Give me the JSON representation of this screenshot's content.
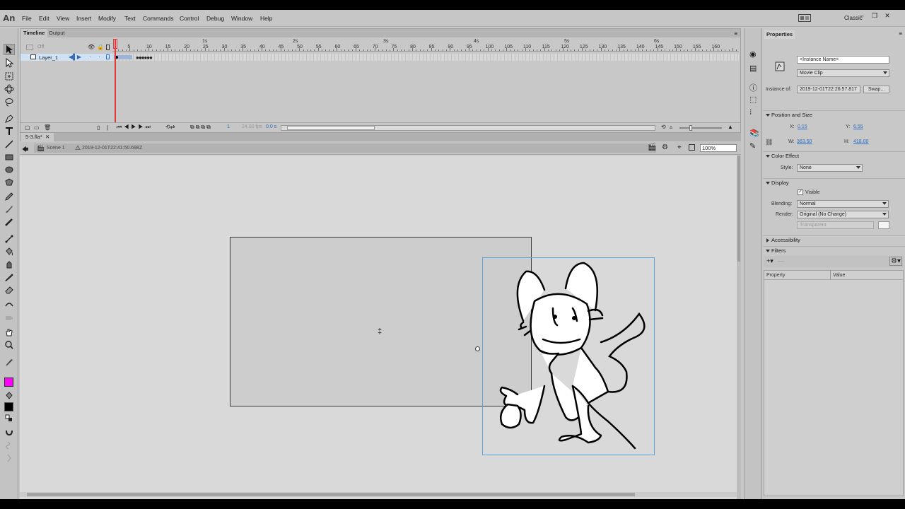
{
  "app": {
    "logo": "An",
    "workspace": "Classic"
  },
  "menu": [
    "File",
    "Edit",
    "View",
    "Insert",
    "Modify",
    "Text",
    "Commands",
    "Control",
    "Debug",
    "Window",
    "Help"
  ],
  "timeline": {
    "tabs": [
      "Timeline",
      "Output"
    ],
    "off_label": "Off",
    "layer_name": "Layer_1",
    "ruler_numbers": [
      "5",
      "10",
      "15",
      "20",
      "25",
      "30",
      "35",
      "40",
      "45",
      "50",
      "55",
      "60",
      "65",
      "70",
      "75",
      "80",
      "85",
      "90",
      "95",
      "100",
      "105",
      "110",
      "115",
      "120",
      "125",
      "130",
      "135",
      "140",
      "145",
      "150",
      "155",
      "160"
    ],
    "seconds": [
      "1s",
      "2s",
      "3s",
      "4s",
      "5s",
      "6s"
    ],
    "current_frame": "1",
    "fps": "24.00 fps",
    "time": "0.0 s"
  },
  "document": {
    "tab_name": "5-3.fla*",
    "scene": "Scene 1",
    "symbol": "2019-12-01T22:41:50.698Z",
    "zoom": "100%"
  },
  "properties": {
    "tab": "Properties",
    "instance_name_placeholder": "<Instance Name>",
    "symbol_type": "Movie Clip",
    "instance_of_label": "Instance of:",
    "instance_of_value": "2019-12-01T22:26:57.817",
    "swap_button": "Swap...",
    "position_size": {
      "header": "Position and Size",
      "x_label": "X:",
      "x": "0.15",
      "y_label": "Y:",
      "y": "6.55",
      "w_label": "W:",
      "w": "363.50",
      "h_label": "H:",
      "h": "418.00"
    },
    "color_effect": {
      "header": "Color Effect",
      "style_label": "Style:",
      "style": "None"
    },
    "display": {
      "header": "Display",
      "visible_label": "Visible",
      "blending_label": "Blending:",
      "blending": "Normal",
      "render_label": "Render:",
      "render": "Original (No Change)",
      "bg_option": "Transparent"
    },
    "accessibility": {
      "header": "Accessibility"
    },
    "filters": {
      "header": "Filters",
      "col_property": "Property",
      "col_value": "Value"
    }
  },
  "colors": {
    "stroke": "#000000",
    "fill": "#ff00ff",
    "playhead": "#e23a3a",
    "selection": "#5ba6d6"
  }
}
